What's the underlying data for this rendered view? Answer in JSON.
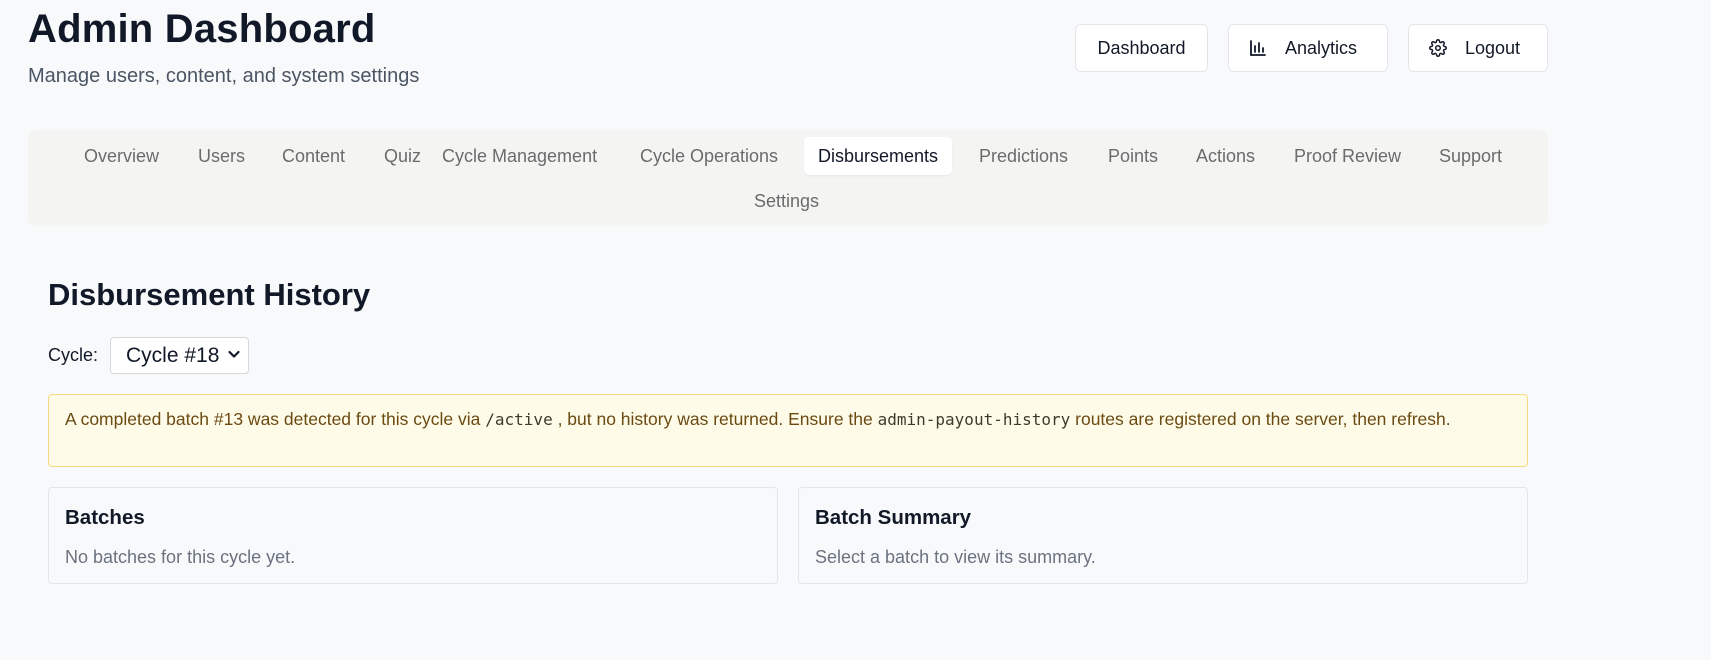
{
  "header": {
    "title": "Admin Dashboard",
    "subtitle": "Manage users, content, and system settings",
    "buttons": {
      "dashboard": "Dashboard",
      "analytics": "Analytics",
      "logout": "Logout"
    },
    "icons": {
      "analytics": "bar-chart-icon",
      "logout": "gear-icon"
    }
  },
  "tabs": [
    {
      "label": "Overview"
    },
    {
      "label": "Users"
    },
    {
      "label": "Content"
    },
    {
      "label": "Quiz"
    },
    {
      "label": "Cycle Management"
    },
    {
      "label": "Cycle Operations"
    },
    {
      "label": "Disbursements",
      "active": true
    },
    {
      "label": "Predictions"
    },
    {
      "label": "Points"
    },
    {
      "label": "Actions"
    },
    {
      "label": "Proof Review"
    },
    {
      "label": "Support"
    },
    {
      "label": "Settings"
    }
  ],
  "section": {
    "title": "Disbursement History",
    "cycle_label": "Cycle:",
    "cycle_selected": "Cycle #18"
  },
  "alert": {
    "text_1": "A completed batch ",
    "batch": "#13",
    "text_2": " was detected for this cycle via ",
    "code_1": "/active",
    "text_3": " , but no history was returned. Ensure the ",
    "code_2": "admin-payout-history",
    "text_4": " routes are registered on the server, then refresh."
  },
  "cards": {
    "batches": {
      "title": "Batches",
      "empty_text": "No batches for this cycle yet."
    },
    "summary": {
      "title": "Batch Summary",
      "empty_text": "Select a batch to view its summary."
    }
  },
  "colors": {
    "background": "#f8f9fb",
    "tab_bar": "#f4f4f3",
    "alert_bg": "#fefce8",
    "alert_border": "#f5d980",
    "alert_text": "#6b4a12"
  }
}
